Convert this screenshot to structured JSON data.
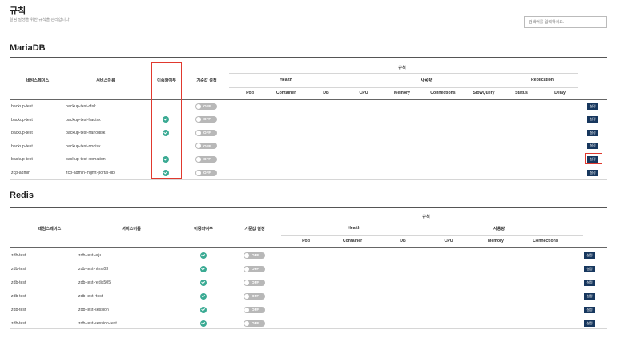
{
  "page": {
    "title": "규칙",
    "description": "알림 발생을 위한 규칙을 관리합니다.",
    "search_placeholder": "검색어를 입력하세요."
  },
  "colors": {
    "check": "#3aaa93",
    "button": "#17375e",
    "highlight": "#e0392e",
    "toggle_off": "#b8b8b8"
  },
  "mariadb": {
    "title": "MariaDB",
    "headers": {
      "namespace": "네임스페이스",
      "service": "서비스이름",
      "redundancy": "이중화여부",
      "default": "기준값 설정",
      "rules": "규칙",
      "health": "Health",
      "usage": "사용량",
      "replication": "Replication",
      "pod": "Pod",
      "container": "Container",
      "db": "DB",
      "cpu": "CPU",
      "memory": "Memory",
      "connections": "Connections",
      "slowquery": "SlowQuery",
      "status": "Status",
      "delay": "Delay"
    },
    "rows": [
      {
        "namespace": "backup-test",
        "service": "backup-test-disk",
        "redundant": false,
        "toggle": "OFF",
        "button": "설정"
      },
      {
        "namespace": "backup-test",
        "service": "backup-test-hadisk",
        "redundant": true,
        "toggle": "OFF",
        "button": "설정"
      },
      {
        "namespace": "backup-test",
        "service": "backup-test-hanodisk",
        "redundant": true,
        "toggle": "OFF",
        "button": "설정"
      },
      {
        "namespace": "backup-test",
        "service": "backup-test-nodisk",
        "redundant": false,
        "toggle": "OFF",
        "button": "설정"
      },
      {
        "namespace": "backup-test",
        "service": "backup-test-xpmation",
        "redundant": true,
        "toggle": "OFF",
        "button": "설정"
      },
      {
        "namespace": "zcp-admin",
        "service": "zcp-admin-mgmt-portal-db",
        "redundant": true,
        "toggle": "OFF",
        "button": "설정"
      }
    ]
  },
  "redis": {
    "title": "Redis",
    "headers": {
      "namespace": "네임스페이스",
      "service": "서비스이름",
      "redundancy": "이중화여부",
      "default": "기준값 설정",
      "rules": "규칙",
      "health": "Health",
      "usage": "사용량",
      "pod": "Pod",
      "container": "Container",
      "db": "DB",
      "cpu": "CPU",
      "memory": "Memory",
      "connections": "Connections"
    },
    "rows": [
      {
        "namespace": "zdb-test",
        "service": "zdb-test-jeju",
        "redundant": true,
        "toggle": "OFF",
        "button": "설정"
      },
      {
        "namespace": "zdb-test",
        "service": "zdb-test-ntest03",
        "redundant": true,
        "toggle": "OFF",
        "button": "설정"
      },
      {
        "namespace": "zdb-test",
        "service": "zdb-test-redis505",
        "redundant": true,
        "toggle": "OFF",
        "button": "설정"
      },
      {
        "namespace": "zdb-test",
        "service": "zdb-test-rtest",
        "redundant": true,
        "toggle": "OFF",
        "button": "설정"
      },
      {
        "namespace": "zdb-test",
        "service": "zdb-test-session",
        "redundant": true,
        "toggle": "OFF",
        "button": "설정"
      },
      {
        "namespace": "zdb-test",
        "service": "zdb-test-session-test",
        "redundant": true,
        "toggle": "OFF",
        "button": "설정"
      }
    ]
  }
}
